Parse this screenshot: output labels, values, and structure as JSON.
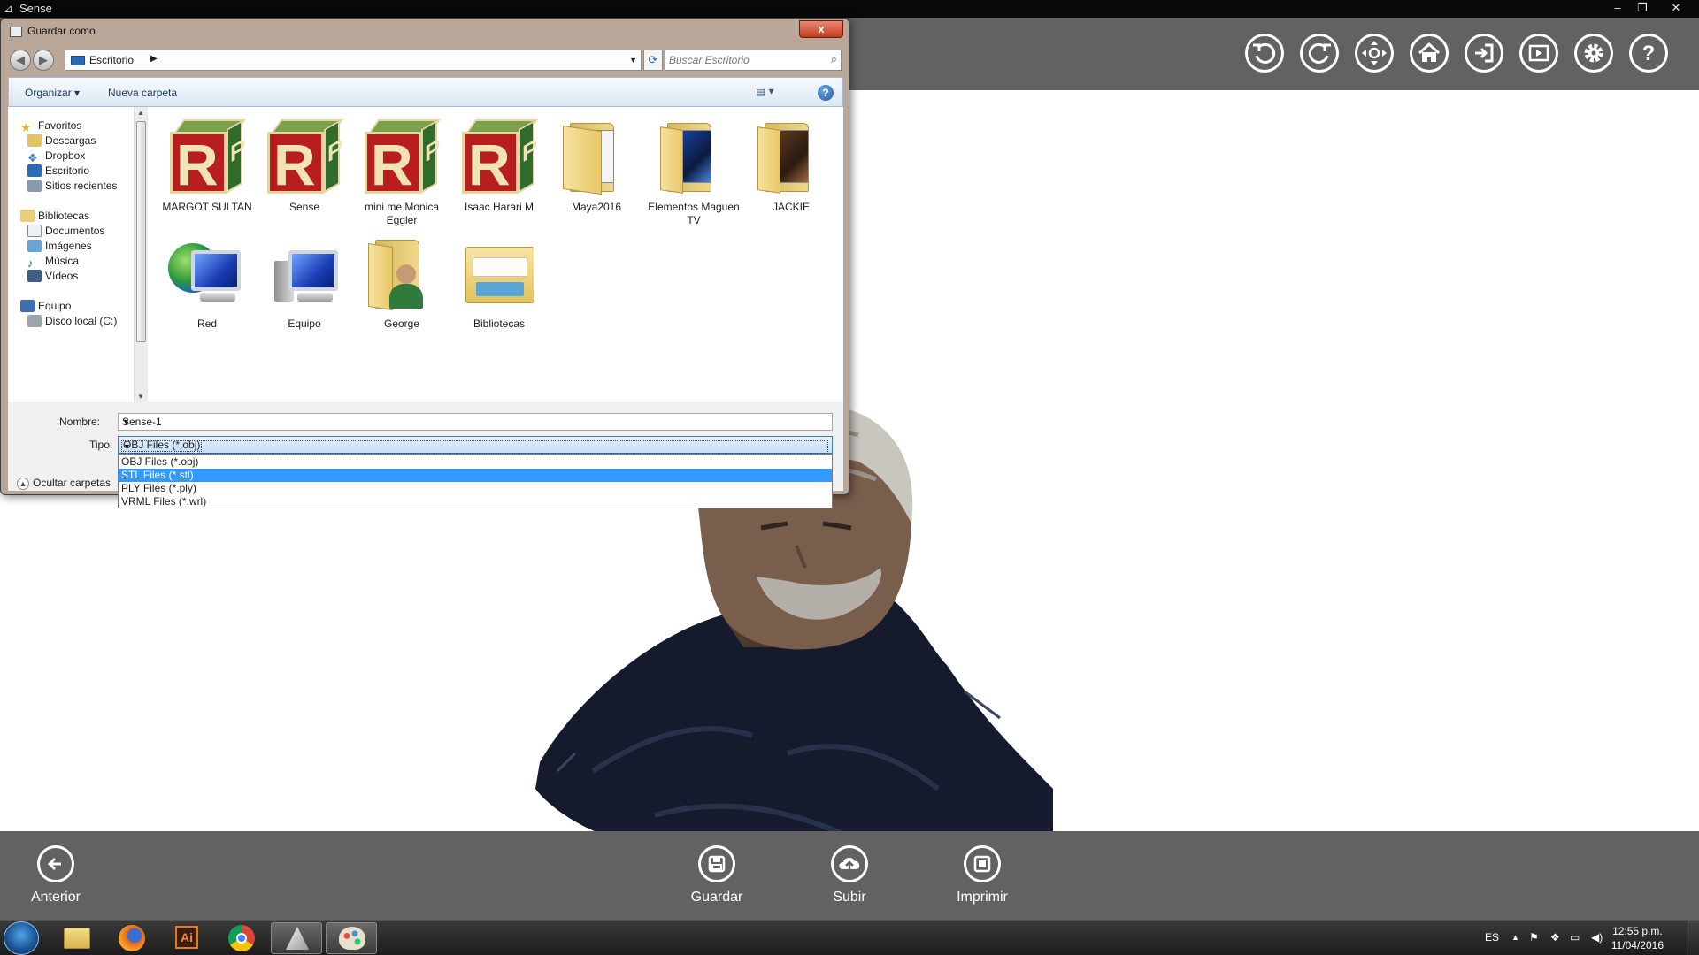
{
  "app": {
    "title": "Sense",
    "toolbar_icons": [
      "rotate-left-icon",
      "rotate-right-icon",
      "move-icon",
      "home-icon",
      "exit-icon",
      "play-icon",
      "gear-icon",
      "help-icon"
    ],
    "bottom": {
      "back_label": "Anterior",
      "save_label": "Guardar",
      "upload_label": "Subir",
      "print_label": "Imprimir"
    },
    "colors": {
      "toolbar_bg": "#626262",
      "viewport_bg": "#ffffff"
    }
  },
  "dialog": {
    "title": "Guardar como",
    "close_glyph": "x",
    "address": "Escritorio",
    "search_placeholder": "Buscar Escritorio",
    "commands": {
      "organize": "Organizar ▾",
      "new_folder": "Nueva carpeta",
      "help": "?"
    },
    "sidebar": {
      "favorites": "Favoritos",
      "downloads": "Descargas",
      "dropbox": "Dropbox",
      "desktop": "Escritorio",
      "recent": "Sitios recientes",
      "libraries": "Bibliotecas",
      "documents": "Documentos",
      "images": "Imágenes",
      "music": "Música",
      "videos": "Vídeos",
      "computer": "Equipo",
      "local_disk": "Disco local (C:)"
    },
    "files": [
      {
        "name": "MARGOT SULTAN",
        "icon": "rp-cube-icon"
      },
      {
        "name": "Sense",
        "icon": "rp-cube-icon"
      },
      {
        "name": "mini me Monica Eggler",
        "icon": "rp-cube-icon"
      },
      {
        "name": "Isaac Harari M",
        "icon": "rp-cube-icon"
      },
      {
        "name": "Maya2016",
        "icon": "folder-icon"
      },
      {
        "name": "Elementos Maguen TV",
        "icon": "folder-icon"
      },
      {
        "name": "JACKIE",
        "icon": "folder-icon"
      },
      {
        "name": "Red",
        "icon": "network-icon"
      },
      {
        "name": "Equipo",
        "icon": "computer-icon"
      },
      {
        "name": "George",
        "icon": "user-folder-icon"
      },
      {
        "name": "Bibliotecas",
        "icon": "libraries-icon"
      }
    ],
    "filename_label": "Nombre:",
    "filename_value": "Sense-1",
    "type_label": "Tipo:",
    "type_value": "OBJ Files (*.obj)",
    "type_options": [
      "OBJ Files (*.obj)",
      "STL Files (*.stl)",
      "PLY Files (*.ply)",
      "VRML Files (*.wrl)"
    ],
    "type_highlighted": "STL Files (*.stl)",
    "hide_folders": "Ocultar carpetas"
  },
  "taskbar": {
    "lang": "ES",
    "time": "12:55 p.m.",
    "date": "11/04/2016"
  }
}
